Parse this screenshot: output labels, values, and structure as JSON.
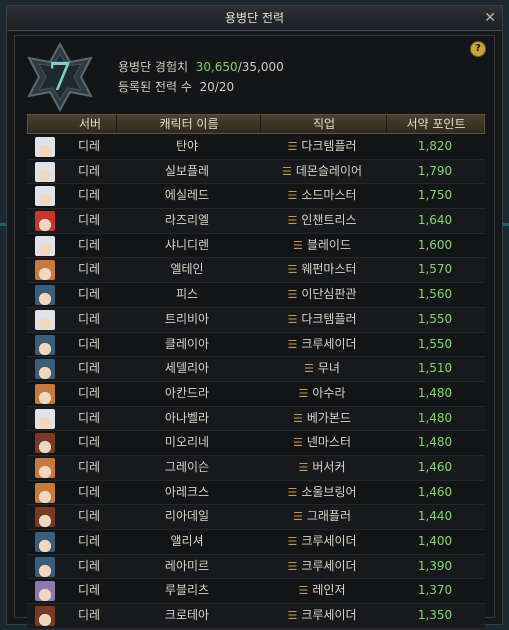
{
  "window": {
    "title": "용병단 전력",
    "close_glyph": "✕",
    "help_glyph": "?"
  },
  "emblem": {
    "level": "7"
  },
  "info": {
    "exp_label": "용병단 경험치",
    "exp_current": "30,650",
    "exp_max": "/35,000",
    "registered_label": "등록된 전력 수",
    "registered_value": "20/20"
  },
  "table": {
    "headers": [
      "서버",
      "캐릭터 이름",
      "직업",
      "서약 포인트"
    ],
    "rows": [
      {
        "avatar": "white-hair",
        "server": "디레",
        "name": "탄야",
        "job": "다크템플러",
        "points": "1,820"
      },
      {
        "avatar": "white-hair",
        "server": "디레",
        "name": "실보플레",
        "job": "데몬슬레이어",
        "points": "1,790"
      },
      {
        "avatar": "white-hair",
        "server": "디레",
        "name": "에실레드",
        "job": "소드마스터",
        "points": "1,750"
      },
      {
        "avatar": "red-hair",
        "server": "디레",
        "name": "라즈리엘",
        "job": "인챈트리스",
        "points": "1,640"
      },
      {
        "avatar": "white-hair",
        "server": "디레",
        "name": "샤니디렌",
        "job": "블레이드",
        "points": "1,600"
      },
      {
        "avatar": "orange-hair",
        "server": "디레",
        "name": "엘테인",
        "job": "웨펀마스터",
        "points": "1,570"
      },
      {
        "avatar": "dark-hair",
        "server": "디레",
        "name": "피스",
        "job": "이단심판관",
        "points": "1,560"
      },
      {
        "avatar": "white-hair",
        "server": "디레",
        "name": "트리비아",
        "job": "다크템플러",
        "points": "1,550"
      },
      {
        "avatar": "dark-hair",
        "server": "디레",
        "name": "클레이아",
        "job": "크루세이더",
        "points": "1,550"
      },
      {
        "avatar": "dark-hair",
        "server": "디레",
        "name": "세델리아",
        "job": "무녀",
        "points": "1,510"
      },
      {
        "avatar": "orange-hair",
        "server": "디레",
        "name": "아칸드라",
        "job": "아수라",
        "points": "1,480"
      },
      {
        "avatar": "white-hair",
        "server": "디레",
        "name": "아나벨라",
        "job": "베가본드",
        "points": "1,480"
      },
      {
        "avatar": "brown-hair",
        "server": "디레",
        "name": "미오리네",
        "job": "넨마스터",
        "points": "1,480"
      },
      {
        "avatar": "orange-hair",
        "server": "디레",
        "name": "그레이슨",
        "job": "버서커",
        "points": "1,460"
      },
      {
        "avatar": "orange-hair",
        "server": "디레",
        "name": "아레크스",
        "job": "소울브링어",
        "points": "1,460"
      },
      {
        "avatar": "brown-hair",
        "server": "디레",
        "name": "리아데일",
        "job": "그래플러",
        "points": "1,440"
      },
      {
        "avatar": "dark-hair",
        "server": "디레",
        "name": "앨리셔",
        "job": "크루세이더",
        "points": "1,400"
      },
      {
        "avatar": "dark-hair",
        "server": "디레",
        "name": "레아미르",
        "job": "크루세이더",
        "points": "1,390"
      },
      {
        "avatar": "purple-hair",
        "server": "디레",
        "name": "루블리츠",
        "job": "레인저",
        "points": "1,370"
      },
      {
        "avatar": "brown-hair",
        "server": "디레",
        "name": "크로테아",
        "job": "크루세이더",
        "points": "1,350"
      }
    ]
  },
  "avatar_colors": {
    "white-hair": "#dfe2e8",
    "red-hair": "#c8362b",
    "orange-hair": "#c87a3a",
    "dark-hair": "#3a5e7a",
    "brown-hair": "#7a3a22",
    "purple-hair": "#8a7ab0"
  },
  "job_icon_glyph": "☰"
}
